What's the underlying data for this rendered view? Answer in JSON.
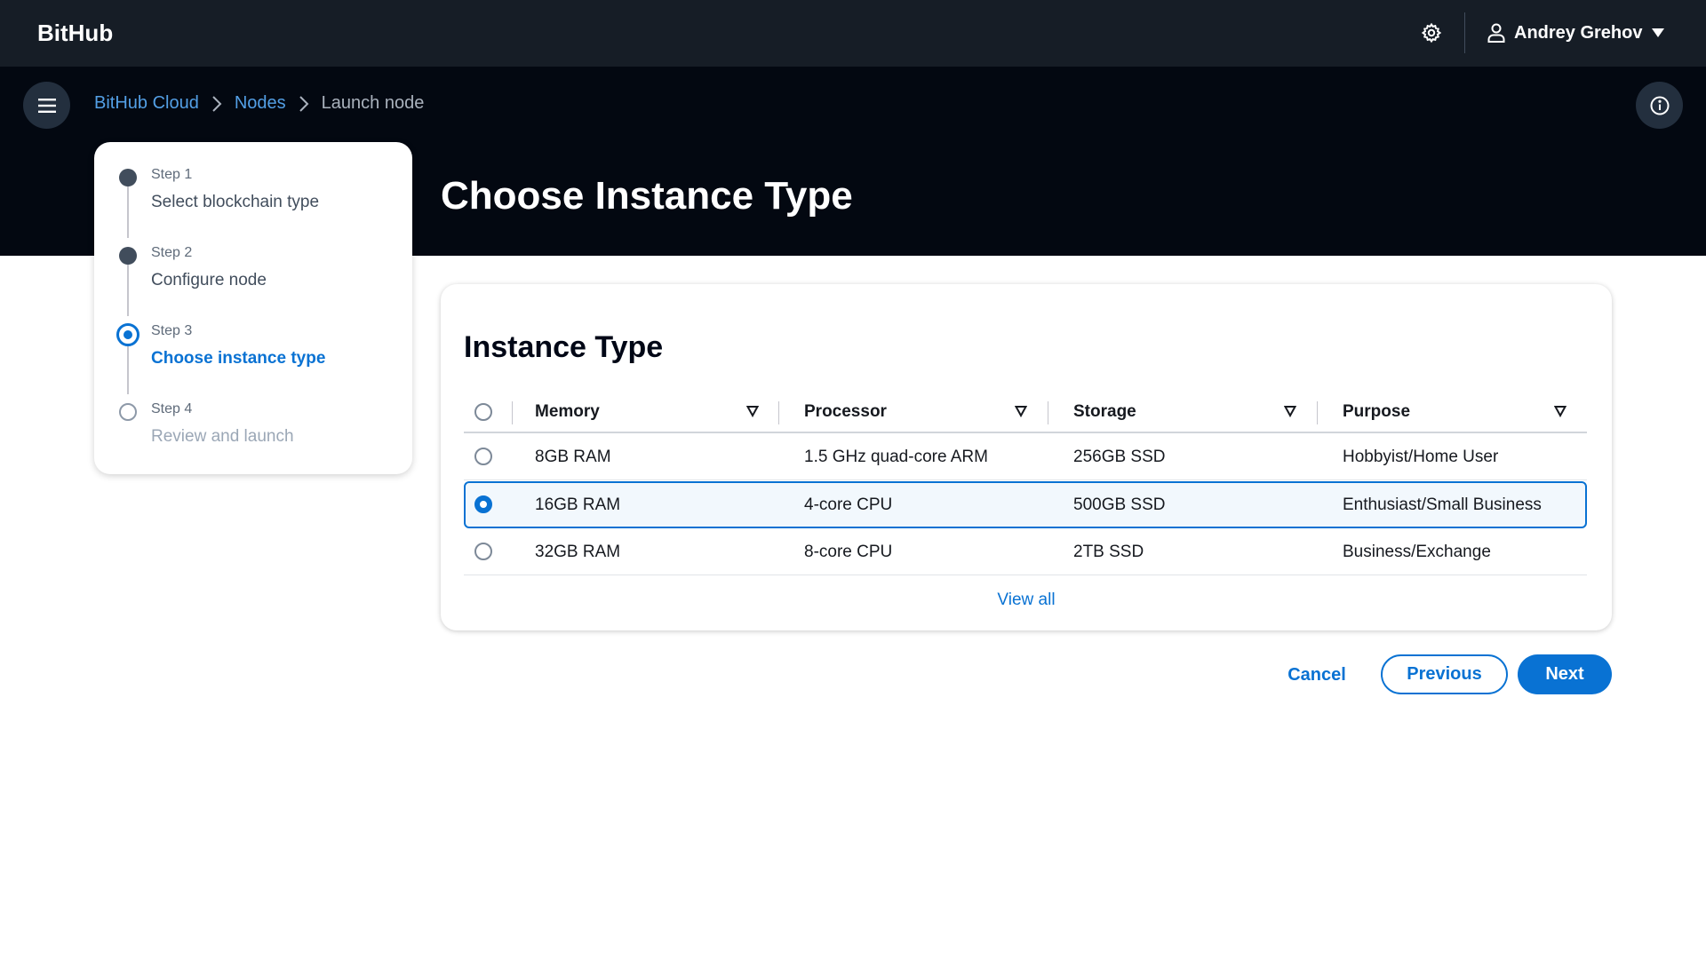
{
  "app": {
    "brand": "BitHub"
  },
  "topbar": {
    "settings_icon": "gear-icon",
    "user_icon": "user-icon",
    "user_name": "Andrey Grehov",
    "dropdown_icon": "caret-down-icon"
  },
  "header": {
    "menu_icon": "hamburger-menu-icon",
    "info_icon": "info-icon",
    "breadcrumbs": [
      {
        "label": "BitHub Cloud"
      },
      {
        "label": "Nodes"
      },
      {
        "label": "Launch node"
      }
    ],
    "page_title": "Choose Instance Type"
  },
  "steps": [
    {
      "number": "Step 1",
      "label": "Select blockchain type",
      "state": "done"
    },
    {
      "number": "Step 2",
      "label": "Configure node",
      "state": "done"
    },
    {
      "number": "Step 3",
      "label": "Choose instance type",
      "state": "current"
    },
    {
      "number": "Step 4",
      "label": "Review and launch",
      "state": "todo"
    }
  ],
  "instance_table": {
    "title": "Instance Type",
    "columns": [
      "Memory",
      "Processor",
      "Storage",
      "Purpose"
    ],
    "rows": [
      {
        "memory": "8GB RAM",
        "processor": "1.5 GHz quad-core ARM",
        "storage": "256GB SSD",
        "purpose": "Hobbyist/Home User",
        "selected": false
      },
      {
        "memory": "16GB RAM",
        "processor": "4-core CPU",
        "storage": "500GB SSD",
        "purpose": "Enthusiast/Small Business",
        "selected": true
      },
      {
        "memory": "32GB RAM",
        "processor": "8-core CPU",
        "storage": "2TB SSD",
        "purpose": "Business/Exchange",
        "selected": false
      }
    ],
    "view_all": "View all"
  },
  "actions": {
    "cancel": "Cancel",
    "previous": "Previous",
    "next": "Next"
  },
  "colors": {
    "primary": "#0972d3",
    "topbar": "#161d26",
    "header_band": "#030811"
  }
}
